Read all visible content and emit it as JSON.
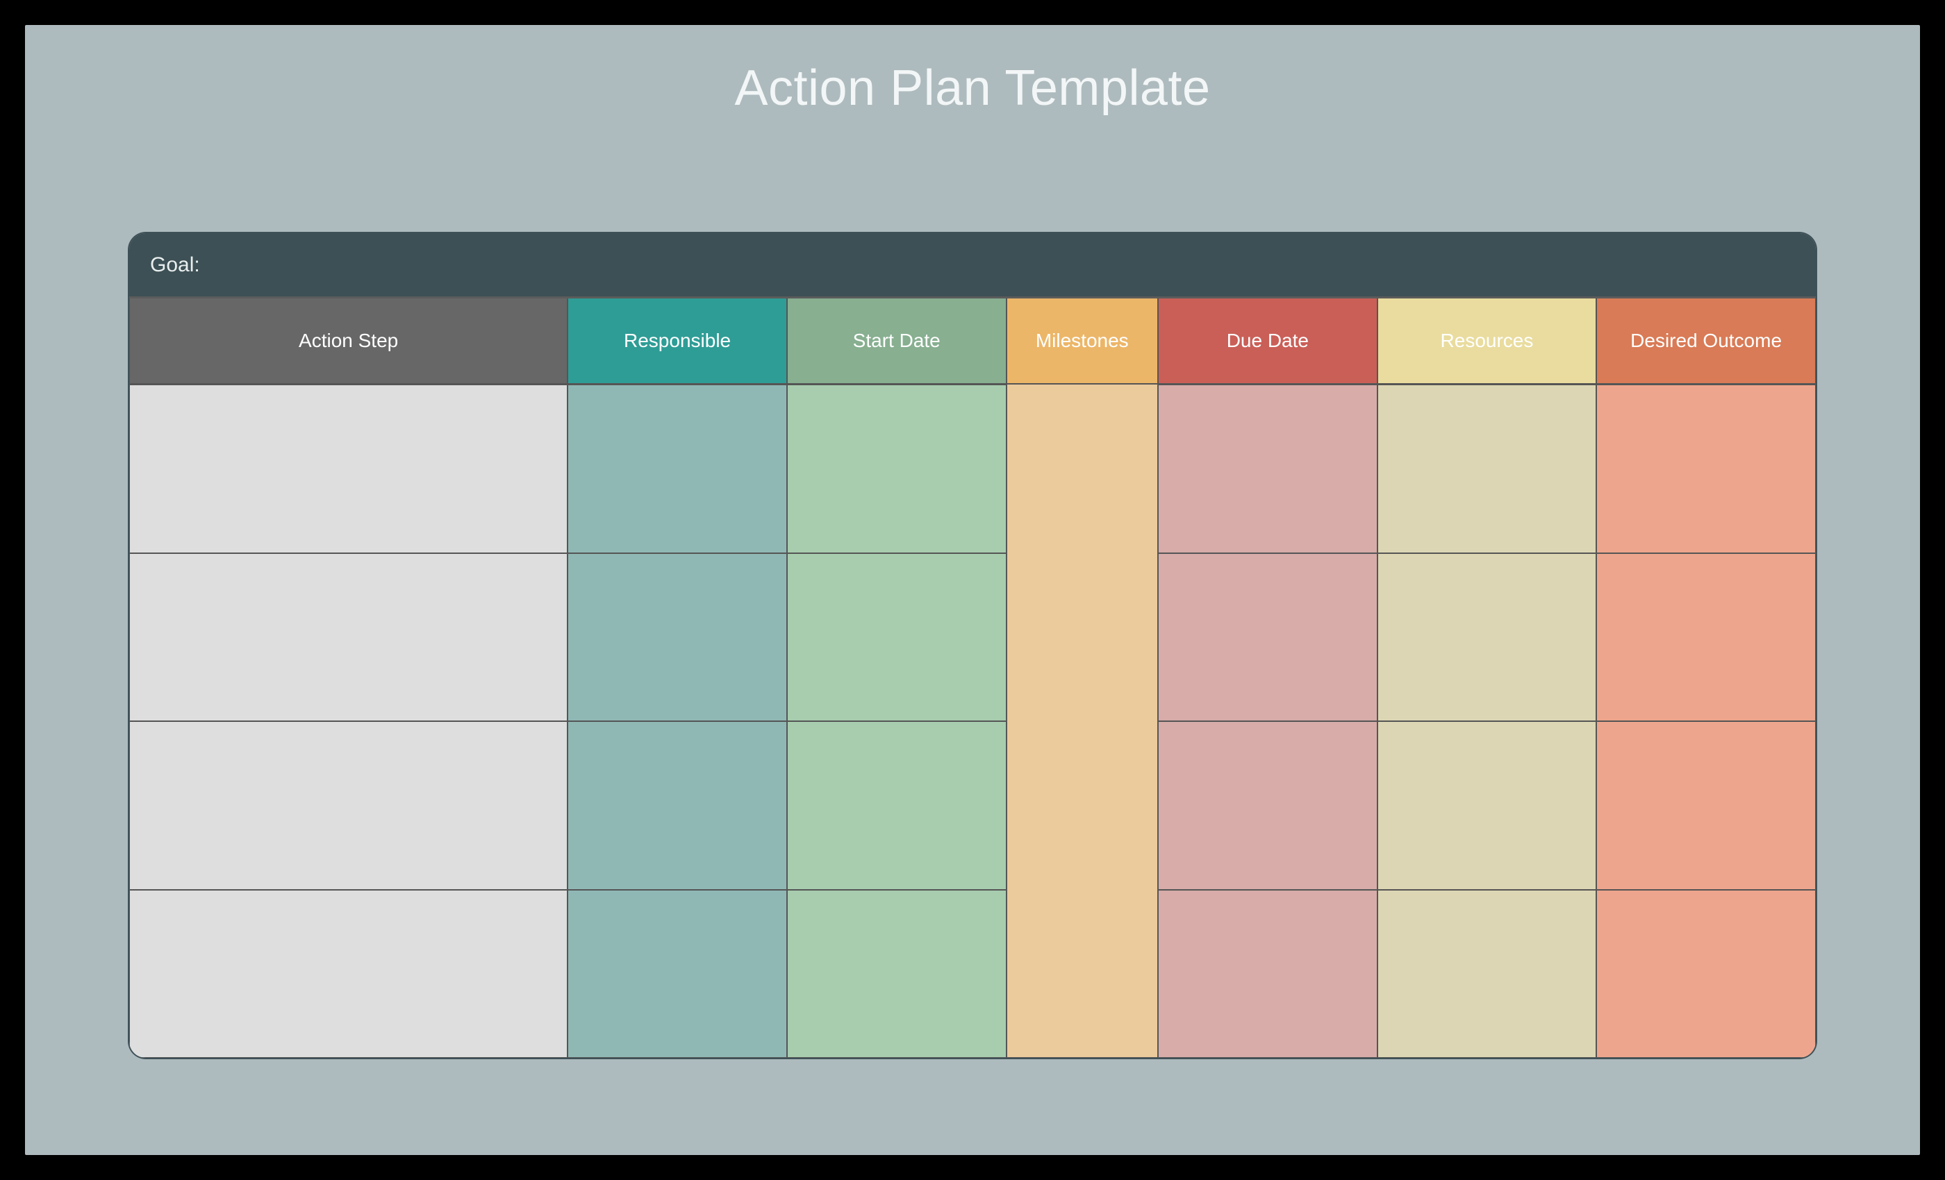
{
  "title": "Action Plan Template",
  "goal_label": "Goal:",
  "columns": {
    "action": "Action Step",
    "responsible": "Responsible",
    "start": "Start Date",
    "milestones": "Milestones",
    "due": "Due Date",
    "resources": "Resources",
    "outcome": "Desired Outcome"
  },
  "rows": [
    {
      "action": "",
      "responsible": "",
      "start": "",
      "milestones": "",
      "due": "",
      "resources": "",
      "outcome": ""
    },
    {
      "action": "",
      "responsible": "",
      "start": "",
      "milestones": "",
      "due": "",
      "resources": "",
      "outcome": ""
    },
    {
      "action": "",
      "responsible": "",
      "start": "",
      "milestones": "",
      "due": "",
      "resources": "",
      "outcome": ""
    },
    {
      "action": "",
      "responsible": "",
      "start": "",
      "milestones": "",
      "due": "",
      "resources": "",
      "outcome": ""
    }
  ],
  "colors": {
    "canvas_bg": "#AEBBBE",
    "goal_bar": "#3D5055",
    "headers": {
      "action": "#676767",
      "responsible": "#2E9D96",
      "start": "#87AF90",
      "milestones": "#ECB668",
      "due": "#CA5F58",
      "resources": "#E9DC9E",
      "outcome": "#D97B56"
    },
    "body": {
      "action": "#DEDEDE",
      "responsible": "#8FB8B5",
      "start": "#A7CDAE",
      "milestones": "#EBCA9C",
      "due": "#D7ACA9",
      "resources": "#DDD6B4",
      "outcome": "#EDA68D"
    }
  }
}
